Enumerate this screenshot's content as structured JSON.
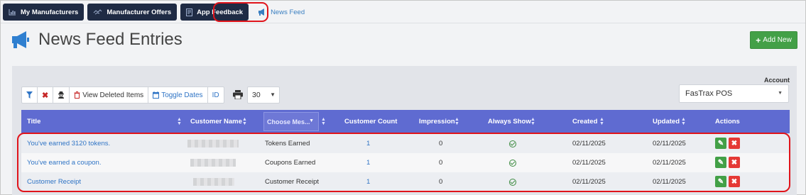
{
  "tabs": [
    {
      "label": "My Manufacturers",
      "icon": "chart-icon"
    },
    {
      "label": "Manufacturer Offers",
      "icon": "handshake-icon"
    },
    {
      "label": "App Feedback",
      "icon": "document-icon"
    },
    {
      "label": "News Feed",
      "icon": "megaphone-icon",
      "active": true
    }
  ],
  "page": {
    "title": "News Feed Entries",
    "add_label": "Add New"
  },
  "toolbar": {
    "view_deleted": "View Deleted Items",
    "toggle_dates": "Toggle Dates",
    "id": "ID",
    "page_size": "30"
  },
  "account": {
    "label": "Account",
    "selected": "FasTrax POS"
  },
  "table": {
    "headers": {
      "title": "Title",
      "customer_name": "Customer Name",
      "choose": "Choose Mes...",
      "customer_count": "Customer Count",
      "impression": "Impression",
      "always_show": "Always Show",
      "created": "Created",
      "updated": "Updated",
      "actions": "Actions"
    },
    "rows": [
      {
        "title": "You've earned 3120 tokens.",
        "message": "Tokens Earned",
        "customer_count": "1",
        "impression": "0",
        "always_show": true,
        "created": "02/11/2025",
        "updated": "02/11/2025"
      },
      {
        "title": "You've earned a coupon.",
        "message": "Coupons Earned",
        "customer_count": "1",
        "impression": "0",
        "always_show": true,
        "created": "02/11/2025",
        "updated": "02/11/2025"
      },
      {
        "title": "Customer Receipt",
        "message": "Customer Receipt",
        "customer_count": "1",
        "impression": "0",
        "always_show": true,
        "created": "02/11/2025",
        "updated": "02/11/2025"
      }
    ]
  },
  "colors": {
    "nav": "#1f2b44",
    "header": "#5f6bd1",
    "accent_link": "#2f74c5",
    "success": "#43a047",
    "danger": "#e53935",
    "highlight": "#e0141b"
  }
}
